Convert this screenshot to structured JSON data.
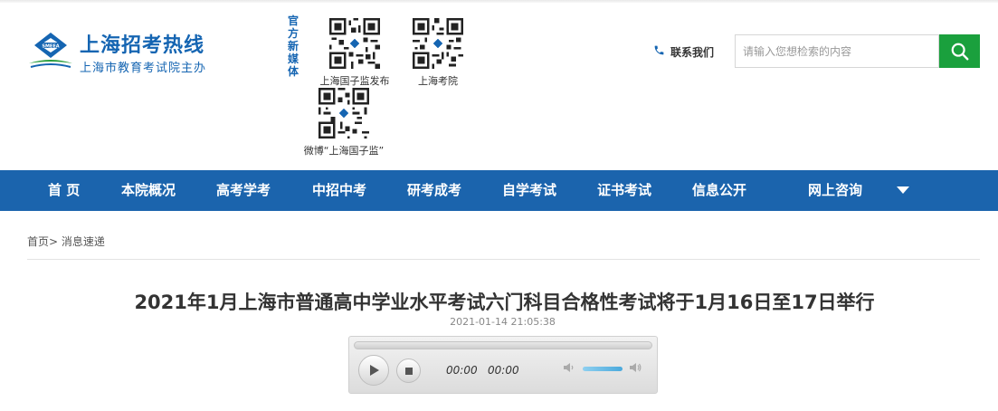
{
  "header": {
    "logo_title": "上海招考热线",
    "logo_subtitle": "上海市教育考试院主办",
    "media_label": "官方新媒体",
    "qr_codes": [
      {
        "caption": "上海国子监发布"
      },
      {
        "caption": "上海考院"
      },
      {
        "caption": "微博“上海国子监”"
      }
    ],
    "contact_label": "联系我们",
    "search_placeholder": "请输入您想检索的内容"
  },
  "nav": {
    "items": [
      {
        "label": "首 页"
      },
      {
        "label": "本院概况"
      },
      {
        "label": "高考学考"
      },
      {
        "label": "中招中考"
      },
      {
        "label": "研考成考"
      },
      {
        "label": "自学考试"
      },
      {
        "label": "证书考试"
      },
      {
        "label": "信息公开"
      },
      {
        "label": "网上咨询"
      }
    ]
  },
  "breadcrumb": {
    "home": "首页",
    "separator": ">",
    "current": "消息速递"
  },
  "article": {
    "title": "2021年1月上海市普通高中学业水平考试六门科目合格性考试将于1月16日至17日举行",
    "date": "2021-01-14 21:05:38"
  },
  "player": {
    "current_time": "00:00",
    "duration": "00:00",
    "progress_fraction": 0,
    "volume_fraction": 0.8
  },
  "colors": {
    "brand_blue": "#1b64ad",
    "search_green": "#1aa03d"
  }
}
